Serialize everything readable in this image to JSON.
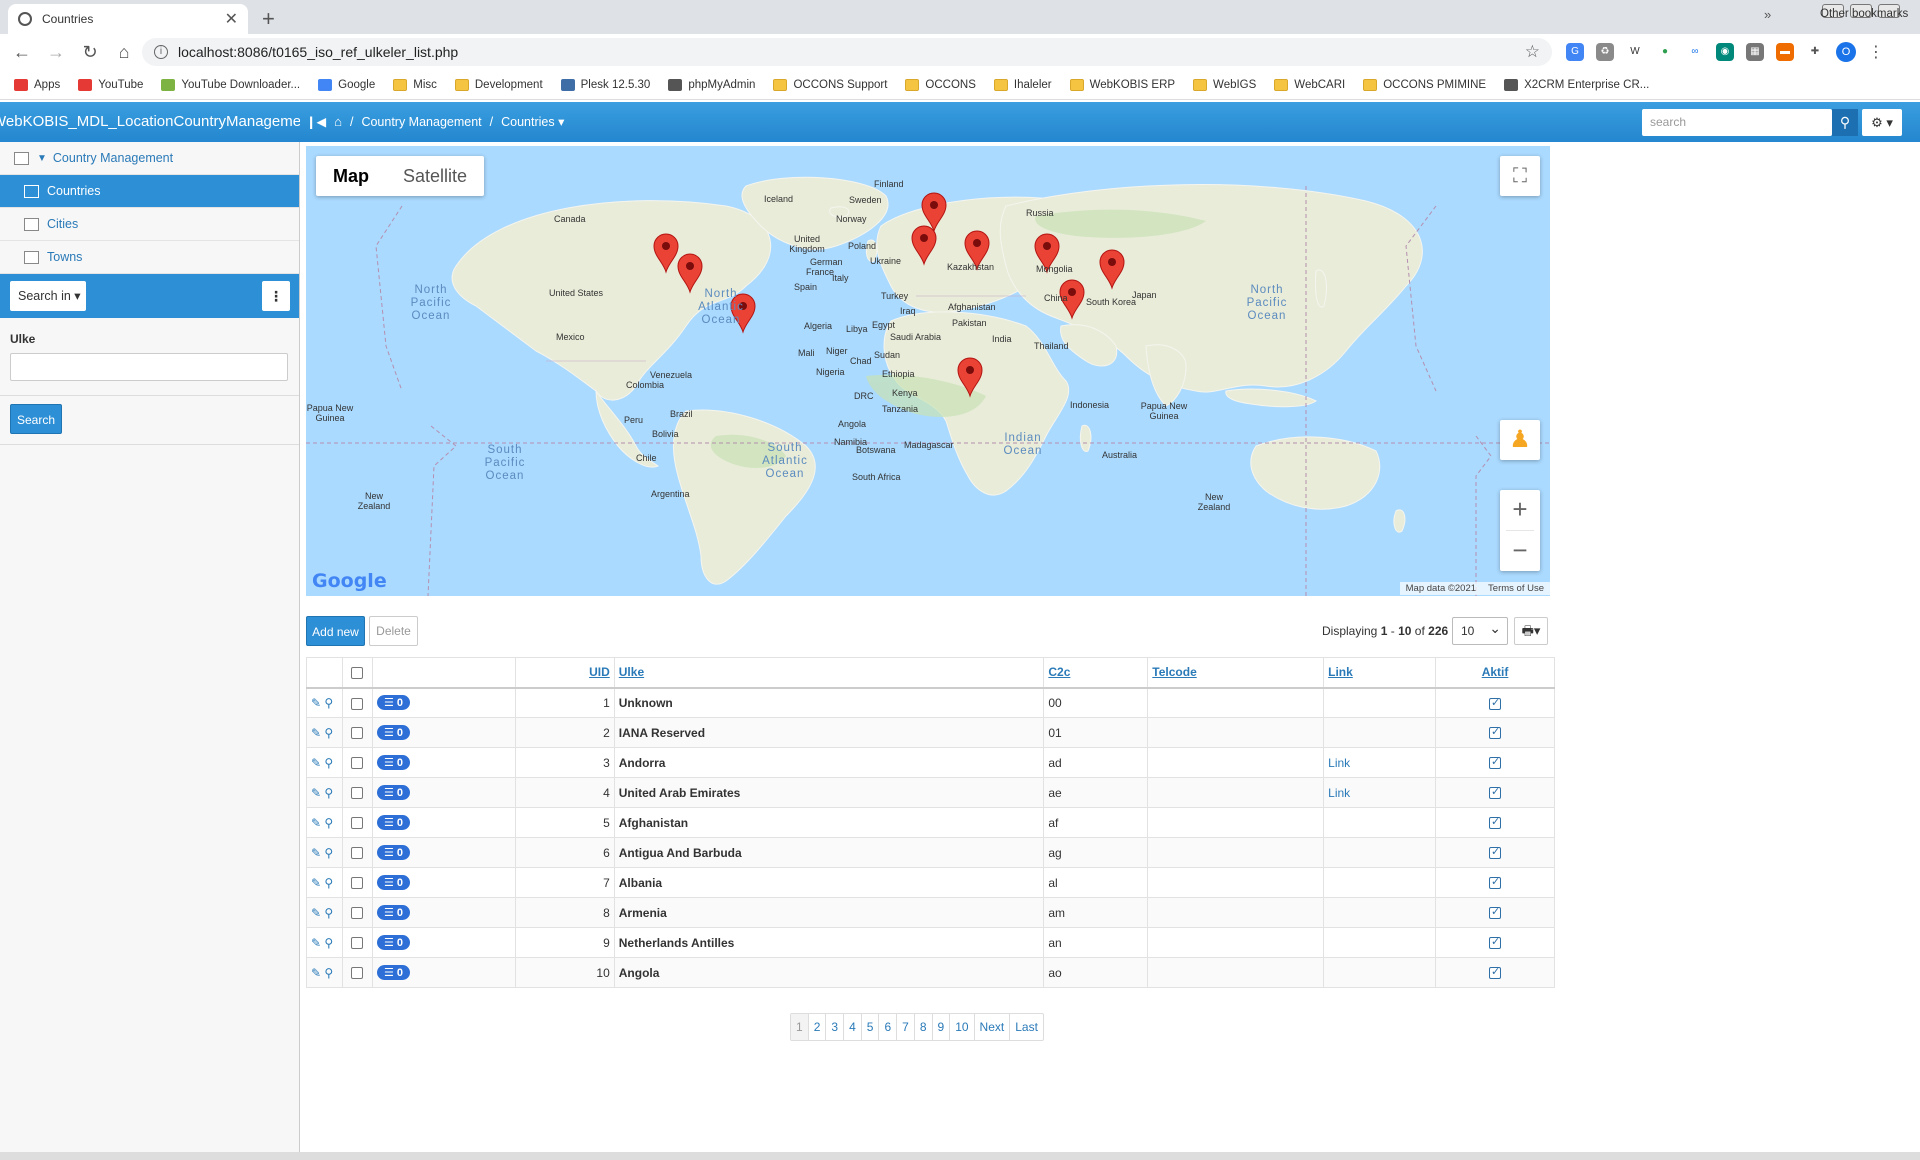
{
  "browser": {
    "tab_title": "Countries",
    "url": "localhost:8086/t0165_iso_ref_ulkeler_list.php",
    "profile_initial": "O",
    "bookmarks": [
      {
        "label": "Apps",
        "icon": "apps-grid-icon",
        "color": "#e53935"
      },
      {
        "label": "YouTube",
        "icon": "youtube-icon",
        "color": "#e53935"
      },
      {
        "label": "YouTube Downloader...",
        "icon": "download-icon",
        "color": "#7cb342"
      },
      {
        "label": "Google",
        "icon": "google-icon",
        "color": "#4285f4"
      },
      {
        "label": "Misc",
        "icon": "folder-icon",
        "color": "#f5c542"
      },
      {
        "label": "Development",
        "icon": "folder-icon",
        "color": "#f5c542"
      },
      {
        "label": "Plesk 12.5.30",
        "icon": "plesk-icon",
        "color": "#3f6ea6"
      },
      {
        "label": "phpMyAdmin",
        "icon": "globe-icon",
        "color": "#555555"
      },
      {
        "label": "OCCONS Support",
        "icon": "folder-icon",
        "color": "#f5c542"
      },
      {
        "label": "OCCONS",
        "icon": "folder-icon",
        "color": "#f5c542"
      },
      {
        "label": "Ihaleler",
        "icon": "folder-icon",
        "color": "#f5c542"
      },
      {
        "label": "WebKOBIS ERP",
        "icon": "folder-icon",
        "color": "#f5c542"
      },
      {
        "label": "WebIGS",
        "icon": "folder-icon",
        "color": "#f5c542"
      },
      {
        "label": "WebCARI",
        "icon": "folder-icon",
        "color": "#f5c542"
      },
      {
        "label": "OCCONS PMIMINE",
        "icon": "folder-icon",
        "color": "#f5c542"
      },
      {
        "label": "X2CRM Enterprise CR...",
        "icon": "x2crm-icon",
        "color": "#555555"
      }
    ],
    "bookmarks_more": "»",
    "other_bookmarks": "Other bookmarks"
  },
  "header": {
    "brand": "WebKOBIS_MDL_LocationCountryManagement",
    "breadcrumb": [
      "Country Management",
      "Countries"
    ],
    "separator": "/",
    "search_placeholder": "search"
  },
  "sidebar": {
    "group": "Country Management",
    "items": [
      "Countries",
      "Cities",
      "Towns"
    ],
    "search_in": "Search in",
    "field_label": "Ulke",
    "search_button": "Search"
  },
  "map": {
    "type_map": "Map",
    "type_satellite": "Satellite",
    "attribution": "Map data ©2021",
    "terms": "Terms of Use",
    "logo": "Google",
    "country_labels": [
      "Iceland",
      "Finland",
      "Sweden",
      "Norway",
      "Russia",
      "Canada",
      "United Kingdom",
      "Poland",
      "Ukraine",
      "Kazakhstan",
      "Mongolia",
      "German",
      "France",
      "Italy",
      "Spain",
      "Turkey",
      "United States",
      "Afghanistan",
      "China",
      "Japan",
      "South Korea",
      "Iraq",
      "Pakistan",
      "Algeria",
      "Libya",
      "Egypt",
      "Saudi Arabia",
      "India",
      "Mexico",
      "Mali",
      "Niger",
      "Chad",
      "Sudan",
      "Thailand",
      "Venezuela",
      "Nigeria",
      "Ethiopia",
      "Colombia",
      "Kenya",
      "DRC",
      "Tanzania",
      "Indonesia",
      "Papua New Guinea",
      "Peru",
      "Brazil",
      "Angola",
      "Bolivia",
      "Namibia",
      "Madagascar",
      "Botswana",
      "Australia",
      "Chile",
      "South Africa",
      "Argentina",
      "New Zealand",
      "New Zealand",
      "Papua New Guinea"
    ],
    "oceans": [
      "North Pacific Ocean",
      "North Atlantic Ocean",
      "North Pacific Ocean",
      "South Pacific Ocean",
      "South Atlantic Ocean",
      "Indian Ocean"
    ]
  },
  "grid": {
    "add_new": "Add new",
    "delete": "Delete",
    "displaying_prefix": "Displaying",
    "range_start": "1",
    "range_sep": "-",
    "range_end": "10",
    "of_word": "of",
    "total": "226",
    "page_size": "10",
    "columns": [
      "UID",
      "Ulke",
      "C2c",
      "Telcode",
      "Link",
      "Aktif"
    ],
    "rows": [
      {
        "uid": "1",
        "name": "Unknown",
        "c2c": "00",
        "telcode": "",
        "link": "",
        "aktif": true,
        "badge": "0"
      },
      {
        "uid": "2",
        "name": "IANA Reserved",
        "c2c": "01",
        "telcode": "",
        "link": "",
        "aktif": true,
        "badge": "0"
      },
      {
        "uid": "3",
        "name": "Andorra",
        "c2c": "ad",
        "telcode": "",
        "link": "Link",
        "aktif": true,
        "badge": "0"
      },
      {
        "uid": "4",
        "name": "United Arab Emirates",
        "c2c": "ae",
        "telcode": "",
        "link": "Link",
        "aktif": true,
        "badge": "0"
      },
      {
        "uid": "5",
        "name": "Afghanistan",
        "c2c": "af",
        "telcode": "",
        "link": "",
        "aktif": true,
        "badge": "0"
      },
      {
        "uid": "6",
        "name": "Antigua And Barbuda",
        "c2c": "ag",
        "telcode": "",
        "link": "",
        "aktif": true,
        "badge": "0"
      },
      {
        "uid": "7",
        "name": "Albania",
        "c2c": "al",
        "telcode": "",
        "link": "",
        "aktif": true,
        "badge": "0"
      },
      {
        "uid": "8",
        "name": "Armenia",
        "c2c": "am",
        "telcode": "",
        "link": "",
        "aktif": true,
        "badge": "0"
      },
      {
        "uid": "9",
        "name": "Netherlands Antilles",
        "c2c": "an",
        "telcode": "",
        "link": "",
        "aktif": true,
        "badge": "0"
      },
      {
        "uid": "10",
        "name": "Angola",
        "c2c": "ao",
        "telcode": "",
        "link": "",
        "aktif": true,
        "badge": "0"
      }
    ]
  },
  "pagination": {
    "pages": [
      "1",
      "2",
      "3",
      "4",
      "5",
      "6",
      "7",
      "8",
      "9",
      "10"
    ],
    "current": "1",
    "next": "Next",
    "last": "Last"
  }
}
